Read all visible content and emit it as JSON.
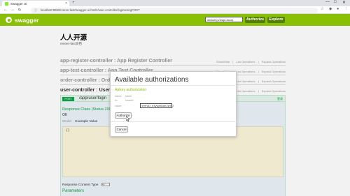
{
  "browser": {
    "tab_title": "Swagger UI",
    "tab_close": "×",
    "new_tab": "+",
    "url": "localhost:8080/renren-fast/swagger-ui.html#/user-controller/loginUsingPOST",
    "window_controls": [
      "—",
      "□",
      "✕"
    ],
    "nav": [
      "←",
      "→",
      "↻"
    ]
  },
  "header": {
    "brand": "swagger",
    "spec_select": "default (/v2/api-docs)",
    "authorize_label": "Authorize",
    "explore_label": "Explore",
    "color": "#89bf04"
  },
  "info": {
    "title": "人人开源",
    "description": "renren-fast文档"
  },
  "controllers": [
    {
      "name": "app-register-controller : App Register Controller",
      "ops": [
        "Show/Hide",
        "List Operations",
        "Expand Operations"
      ]
    },
    {
      "name": "app-test-controller : App Test Controller",
      "ops": [
        "Show/Hide",
        "List Operations",
        "Expand Operations"
      ]
    },
    {
      "name": "order-controller : Order Controller",
      "ops": [
        "Show/Hide",
        "List Operations",
        "Expand Operations"
      ]
    }
  ],
  "user_controller": {
    "name": "user-controller : User Controller",
    "ops": [
      "Show/Hide",
      "List Operations",
      "Expand Operations"
    ]
  },
  "operation": {
    "method": "POST",
    "path": "/app/user/login",
    "right_label": "登录",
    "response_class": "Response Class (Status 200)",
    "status_text": "OK",
    "model_label": "Model",
    "example_label": "Example Value",
    "example_code": "{}",
    "response_content_type_label": "Response Content Type",
    "response_content_type_value": "*/*",
    "parameters_label": "Parameters"
  },
  "modal": {
    "title": "Available authorizations",
    "auth_name": "Apikey authorization",
    "name_key": "name:",
    "name_val": "token",
    "in_key": "in:",
    "in_val": "header",
    "value_key": "value:",
    "value_input": "YHFzD_nTyvpeDuKTaYQ",
    "authorize_button": "Authorize",
    "cancel_button": "Cancel"
  }
}
